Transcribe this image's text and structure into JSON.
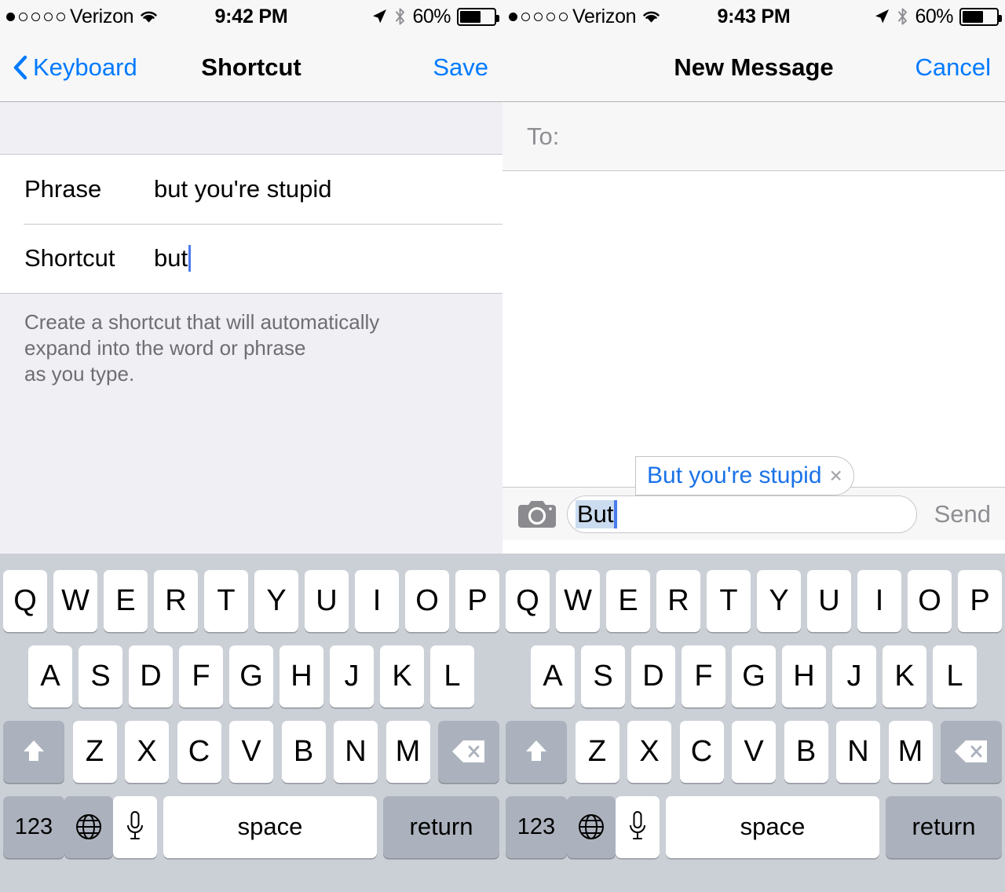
{
  "left_screen": {
    "statusbar": {
      "carrier": "Verizon",
      "time": "9:42 PM",
      "battery_percent": "60%",
      "battery_level": 60,
      "signal_filled_dots": 1,
      "signal_total_dots": 5,
      "icons": [
        "wifi-icon",
        "location-arrow-icon",
        "bluetooth-icon",
        "battery-icon"
      ]
    },
    "navbar": {
      "back_label": "Keyboard",
      "title": "Shortcut",
      "action_label": "Save"
    },
    "rows": [
      {
        "label": "Phrase",
        "value": "but you're stupid",
        "has_caret": false
      },
      {
        "label": "Shortcut",
        "value": "but",
        "has_caret": true
      }
    ],
    "footnote": "Create a shortcut that will automatically\n expand into the word or phrase\n as you type."
  },
  "right_screen": {
    "statusbar": {
      "carrier": "Verizon",
      "time": "9:43 PM",
      "battery_percent": "60%",
      "battery_level": 60,
      "signal_filled_dots": 1,
      "signal_total_dots": 5
    },
    "navbar": {
      "title": "New Message",
      "action_label": "Cancel"
    },
    "to_field": {
      "label": "To:",
      "value": ""
    },
    "compose": {
      "camera_icon": "camera-icon",
      "message_value": "But",
      "send_label": "Send",
      "autocomplete": {
        "suggestion": "But you're stupid",
        "dismiss_glyph": "×"
      }
    }
  },
  "keyboard": {
    "row1": [
      "Q",
      "W",
      "E",
      "R",
      "T",
      "Y",
      "U",
      "I",
      "O",
      "P"
    ],
    "row2": [
      "A",
      "S",
      "D",
      "F",
      "G",
      "H",
      "J",
      "K",
      "L"
    ],
    "row3": [
      "Z",
      "X",
      "C",
      "V",
      "B",
      "N",
      "M"
    ],
    "shift_icon": "shift-arrow-icon",
    "delete_icon": "backspace-icon",
    "numeric_label": "123",
    "globe_icon": "globe-icon",
    "mic_icon": "microphone-icon",
    "space_label": "space",
    "return_label": "return"
  },
  "colors": {
    "accent_blue": "#007AFF",
    "suggestion_blue": "#1A72E8",
    "caret_blue": "#4A7BEC",
    "selection_blue": "#CBDCF0",
    "keyboard_bg": "#CBD0D7",
    "key_dark": "#ABB2BD",
    "group_bg": "#EFEFF4",
    "bar_bg": "#F7F7F7",
    "footnote_gray": "#6D6D72",
    "placeholder_gray": "#8E8E93"
  }
}
